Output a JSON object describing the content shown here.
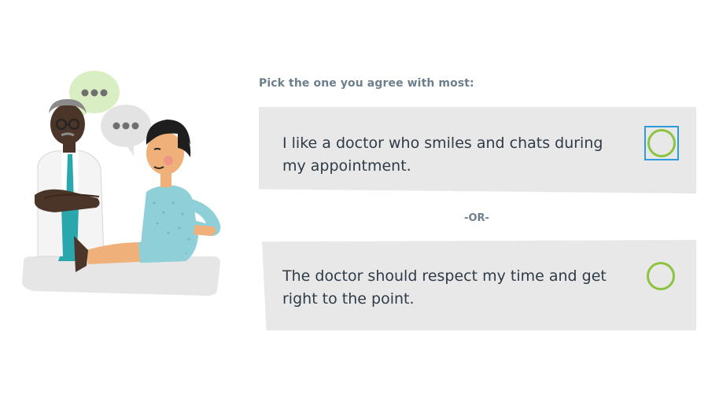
{
  "question": {
    "prompt": "Pick the one you agree with most:",
    "divider": "-OR-"
  },
  "options": [
    {
      "text": "I like a doctor who smiles and chats during my appointment.",
      "selected": false,
      "focused": true
    },
    {
      "text": "The doctor should respect my time and get right to the point.",
      "selected": false,
      "focused": false
    }
  ],
  "colors": {
    "radio_ring": "#8cc43f",
    "focus_outline": "#2d9be0",
    "option_background": "#e8e8e8",
    "prompt_text": "#6e7f8c",
    "option_text": "#2f3b47"
  },
  "icons": {
    "speech_bubble_doctor": "speech-bubble-icon",
    "speech_bubble_patient": "speech-bubble-icon"
  }
}
